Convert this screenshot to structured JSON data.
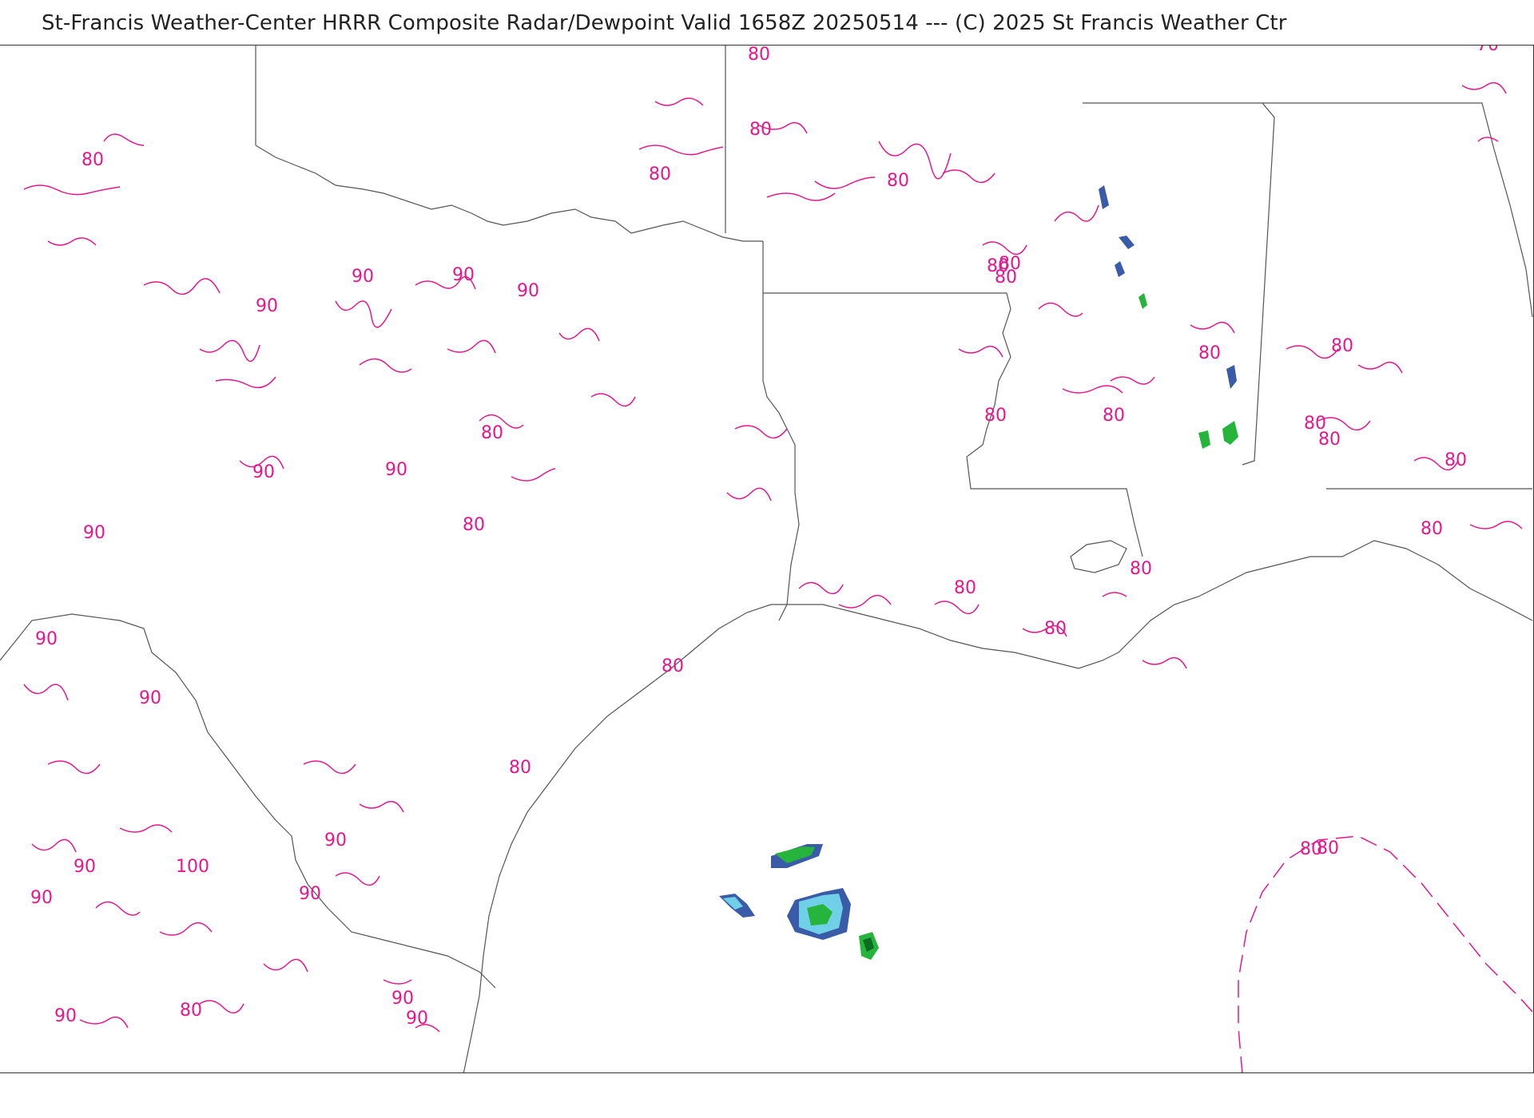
{
  "header": {
    "title": "St-Francis Weather-Center HRRR Composite Radar/Dewpoint  Valid  1658Z 20250514  --- (C) 2025 St Francis Weather Ctr"
  },
  "colors": {
    "contour": "#e5178c",
    "boundary": "#555555",
    "radar_light": "#6fd0e8",
    "radar_mid": "#3a5ca8",
    "radar_green": "#26b43c",
    "radar_dark_green": "#0b6e1e"
  },
  "contour_labels": [
    "80",
    "80",
    "80",
    "80",
    "80",
    "90",
    "90",
    "90",
    "90",
    "90",
    "80",
    "90",
    "90",
    "80",
    "90",
    "80",
    "80",
    "80",
    "80",
    "80",
    "80",
    "80",
    "80",
    "80",
    "80",
    "80",
    "80",
    "80",
    "80",
    "80",
    "80",
    "80",
    "90",
    "90",
    "90",
    "100",
    "90",
    "90",
    "90",
    "90",
    "80",
    "90",
    "80",
    "70"
  ]
}
